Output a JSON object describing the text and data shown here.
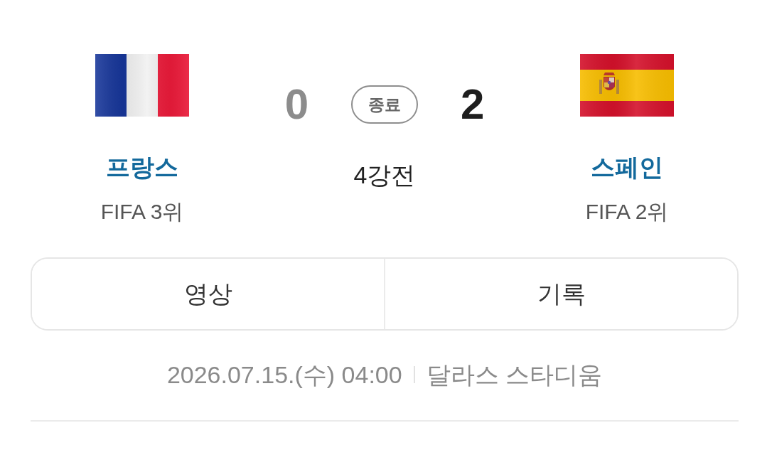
{
  "teams": [
    {
      "name": "프랑스",
      "rank": "FIFA 3위",
      "score": "0",
      "winner": false
    },
    {
      "name": "스페인",
      "rank": "FIFA 2위",
      "score": "2",
      "winner": true
    }
  ],
  "match": {
    "status": "종료",
    "round": "4강전"
  },
  "links": [
    {
      "label": "영상"
    },
    {
      "label": "기록"
    }
  ],
  "schedule": {
    "datetime": "2026.07.15.(수) 04:00",
    "venue": "달라스 스타디움"
  }
}
